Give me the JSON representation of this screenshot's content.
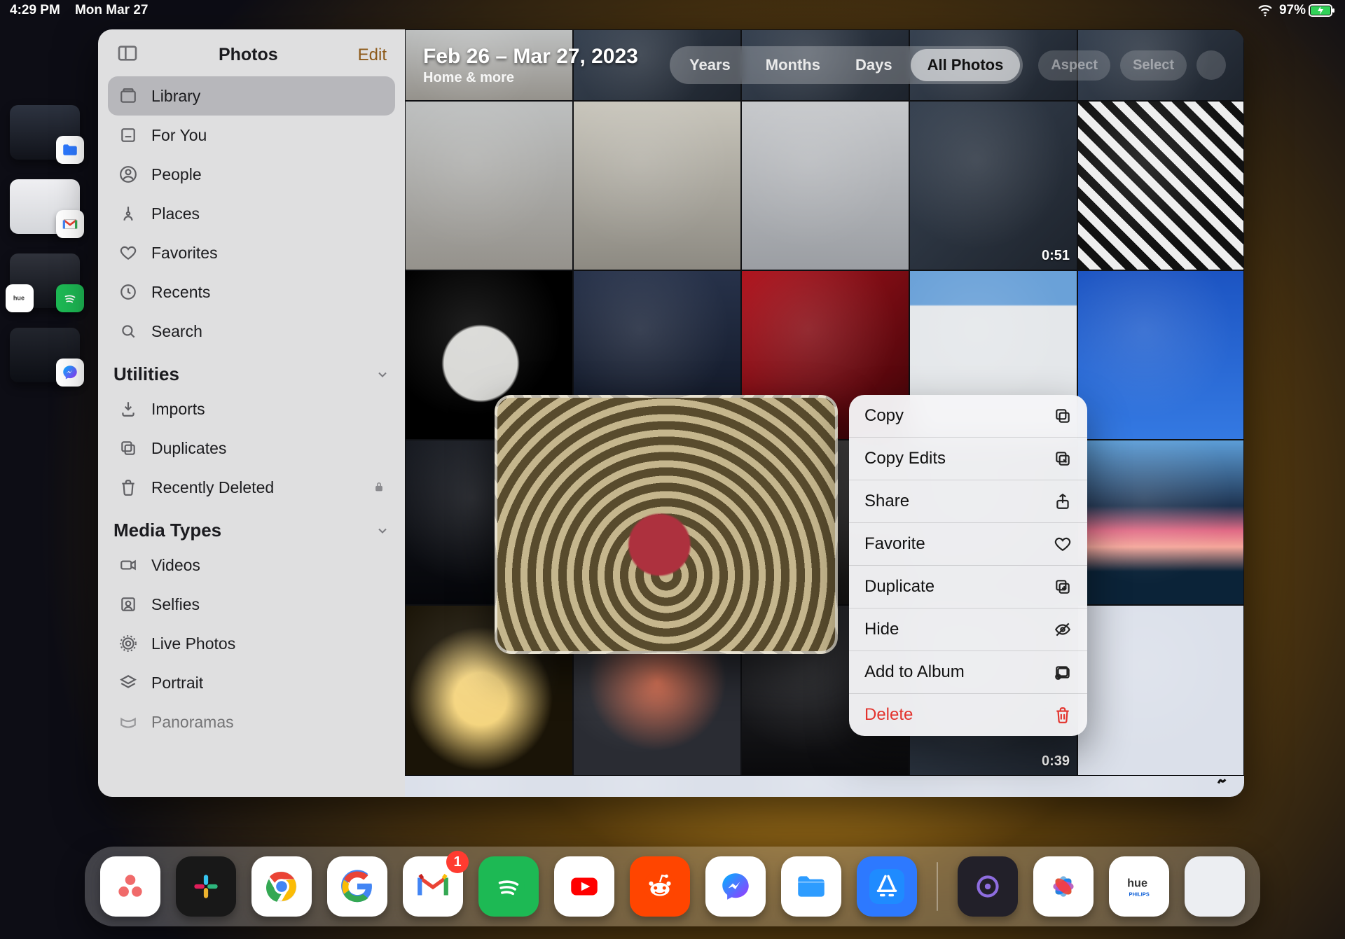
{
  "statusbar": {
    "time": "4:29 PM",
    "date": "Mon Mar 27",
    "battery_pct": "97%"
  },
  "photos": {
    "app_title": "Photos",
    "edit_label": "Edit",
    "header": {
      "range": "Feb 26 – Mar 27, 2023",
      "subtitle": "Home & more"
    },
    "segmented": [
      "Years",
      "Months",
      "Days",
      "All Photos"
    ],
    "segmented_active": 3,
    "actions": {
      "aspect": "Aspect",
      "select": "Select"
    },
    "sidebar": {
      "primary": [
        {
          "label": "Library"
        },
        {
          "label": "For You"
        },
        {
          "label": "People"
        },
        {
          "label": "Places"
        },
        {
          "label": "Favorites"
        },
        {
          "label": "Recents"
        },
        {
          "label": "Search"
        }
      ],
      "utilities_title": "Utilities",
      "utilities": [
        {
          "label": "Imports"
        },
        {
          "label": "Duplicates"
        },
        {
          "label": "Recently Deleted",
          "locked": true
        }
      ],
      "media_title": "Media Types",
      "media": [
        {
          "label": "Videos"
        },
        {
          "label": "Selfies"
        },
        {
          "label": "Live Photos"
        },
        {
          "label": "Portrait"
        },
        {
          "label": "Panoramas"
        }
      ]
    },
    "durations": {
      "v1": "0:51",
      "v2": "0:39"
    },
    "context_menu": [
      {
        "label": "Copy",
        "icon": "doc.on.doc"
      },
      {
        "label": "Copy Edits",
        "icon": "square.on.square.pencil"
      },
      {
        "label": "Share",
        "icon": "square.and.arrow.up"
      },
      {
        "label": "Favorite",
        "icon": "heart"
      },
      {
        "label": "Duplicate",
        "icon": "plus.square.on.square"
      },
      {
        "label": "Hide",
        "icon": "eye.slash"
      },
      {
        "label": "Add to Album",
        "icon": "rectangle.stack.badge.plus"
      },
      {
        "label": "Delete",
        "icon": "trash",
        "destructive": true
      }
    ]
  },
  "dock": {
    "apps": [
      {
        "name": "Asana"
      },
      {
        "name": "Slack"
      },
      {
        "name": "Chrome"
      },
      {
        "name": "Google"
      },
      {
        "name": "Gmail",
        "badge": "1"
      },
      {
        "name": "Spotify"
      },
      {
        "name": "YouTube"
      },
      {
        "name": "Reddit"
      },
      {
        "name": "Messenger"
      },
      {
        "name": "Files"
      },
      {
        "name": "App Store"
      }
    ],
    "recents": [
      {
        "name": "Smart Home"
      },
      {
        "name": "Photos"
      },
      {
        "name": "Hue"
      },
      {
        "name": "App Library"
      }
    ]
  }
}
